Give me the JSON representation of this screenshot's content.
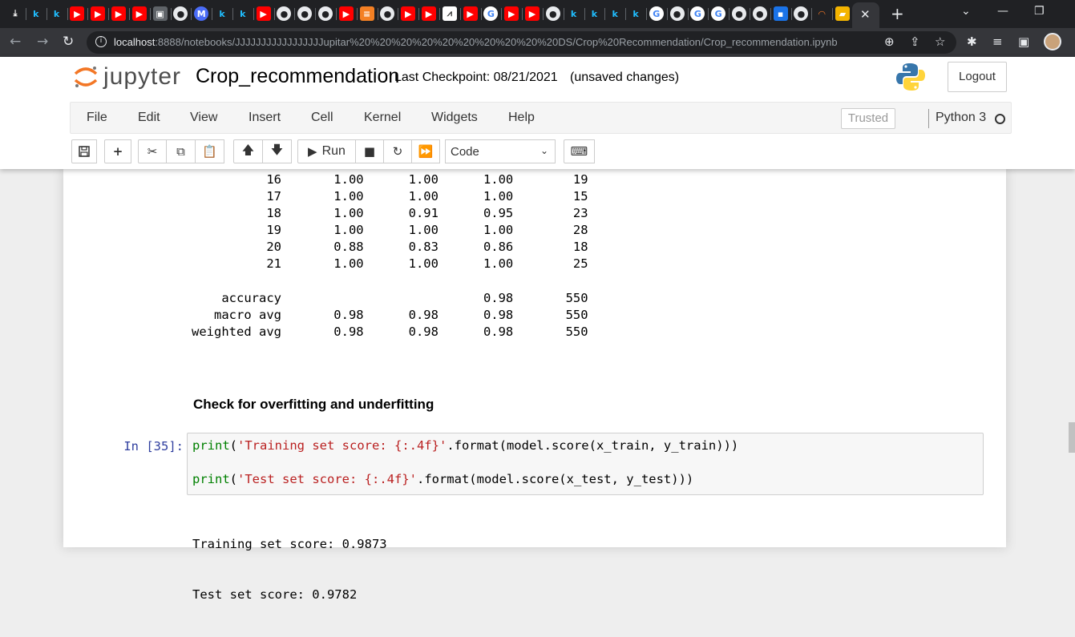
{
  "browser": {
    "url_host": "localhost",
    "url_rest": ":8888/notebooks/JJJJJJJJJJJJJJJJJupitar%20%20%20%20%20%20%20%20%20%20DS/Crop%20Recommendation/Crop_recommendation.ipynb",
    "tab_icons": [
      "download",
      "k",
      "k",
      "yt",
      "yt",
      "yt",
      "yt",
      "save",
      "gh",
      "m",
      "k",
      "k",
      "yt",
      "gh",
      "gh",
      "gh",
      "yt",
      "so",
      "gh",
      "yt",
      "yt",
      "chart",
      "yt",
      "g",
      "yt",
      "yt",
      "gh",
      "k",
      "k",
      "k",
      "k",
      "g",
      "gh",
      "g",
      "g",
      "gh",
      "gh",
      "dl",
      "gh",
      "jupyter",
      "book"
    ],
    "new_tab": "+",
    "close_tab": "✕"
  },
  "jupyter": {
    "logo_text": "jupyter",
    "notebook_name": "Crop_recommendation",
    "checkpoint": "Last Checkpoint: 08/21/2021",
    "unsaved": "(unsaved changes)",
    "logout_label": "Logout",
    "menu": [
      "File",
      "Edit",
      "View",
      "Insert",
      "Cell",
      "Kernel",
      "Widgets",
      "Help"
    ],
    "trusted_label": "Trusted",
    "kernel_name": "Python 3",
    "run_label": "Run",
    "cell_type": "Code"
  },
  "report": {
    "rows": [
      {
        "label": "16",
        "precision": "1.00",
        "recall": "1.00",
        "f1": "1.00",
        "support": "19"
      },
      {
        "label": "17",
        "precision": "1.00",
        "recall": "1.00",
        "f1": "1.00",
        "support": "15"
      },
      {
        "label": "18",
        "precision": "1.00",
        "recall": "0.91",
        "f1": "0.95",
        "support": "23"
      },
      {
        "label": "19",
        "precision": "1.00",
        "recall": "1.00",
        "f1": "1.00",
        "support": "28"
      },
      {
        "label": "20",
        "precision": "0.88",
        "recall": "0.83",
        "f1": "0.86",
        "support": "18"
      },
      {
        "label": "21",
        "precision": "1.00",
        "recall": "1.00",
        "f1": "1.00",
        "support": "25"
      }
    ],
    "summary": [
      {
        "label": "accuracy",
        "precision": "",
        "recall": "",
        "f1": "0.98",
        "support": "550"
      },
      {
        "label": "macro avg",
        "precision": "0.98",
        "recall": "0.98",
        "f1": "0.98",
        "support": "550"
      },
      {
        "label": "weighted avg",
        "precision": "0.98",
        "recall": "0.98",
        "f1": "0.98",
        "support": "550"
      }
    ]
  },
  "markdown_heading": "Check for overfitting and underfitting",
  "code_cell": {
    "prompt": "In [35]:",
    "line1_fn": "print",
    "line1_open": "(",
    "line1_str": "'Training set score: {:.4f}'",
    "line1_rest": ".format(model.score(x_train, y_train)))",
    "line2_fn": "print",
    "line2_open": "(",
    "line2_str": "'Test set score: {:.4f}'",
    "line2_rest": ".format(model.score(x_test, y_test)))"
  },
  "output": {
    "line1": "Training set score: 0.9873",
    "line2": "Test set score: 0.9782"
  },
  "colors": {
    "prompt_in": "#303f9f",
    "keyword": "#008000",
    "string": "#ba2121"
  }
}
